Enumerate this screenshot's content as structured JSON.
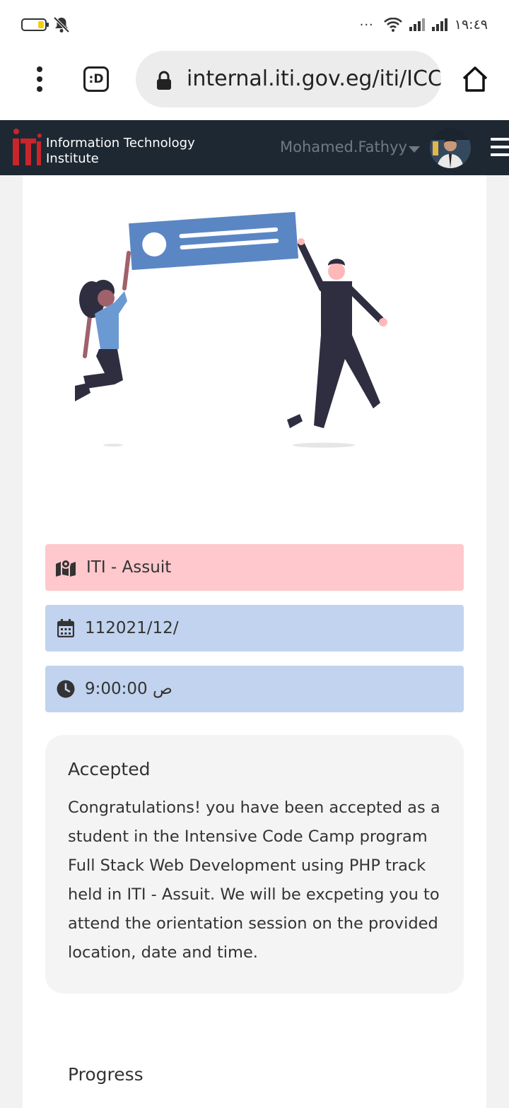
{
  "status_bar": {
    "time": "١٩:٤٩",
    "more": "···"
  },
  "browser": {
    "tabs_label": ":D",
    "url": "internal.iti.gov.eg/iti/ICC"
  },
  "navbar": {
    "brand_line1": "Information Technology",
    "brand_line2": "Institute",
    "username": "Mohamed.Fathyy"
  },
  "details": {
    "location": "ITI - Assuit",
    "date": "112021/12/",
    "time": "9:00:00 ص"
  },
  "application_status": {
    "title": "Accepted",
    "message": "Congratulations! you have been accepted as a student in the Intensive Code Camp program Full Stack Web Development using PHP track held in ITI - Assuit. We will be excpeting you to attend the orientation session on the provided location, date and time."
  },
  "progress_heading": "Progress",
  "colors": {
    "navbar_bg": "#1e2832",
    "location_bg": "#fec8cd",
    "date_time_bg": "#c1d3ee",
    "brand_red": "#c8252c",
    "illustration_blue": "#5b86c4"
  }
}
